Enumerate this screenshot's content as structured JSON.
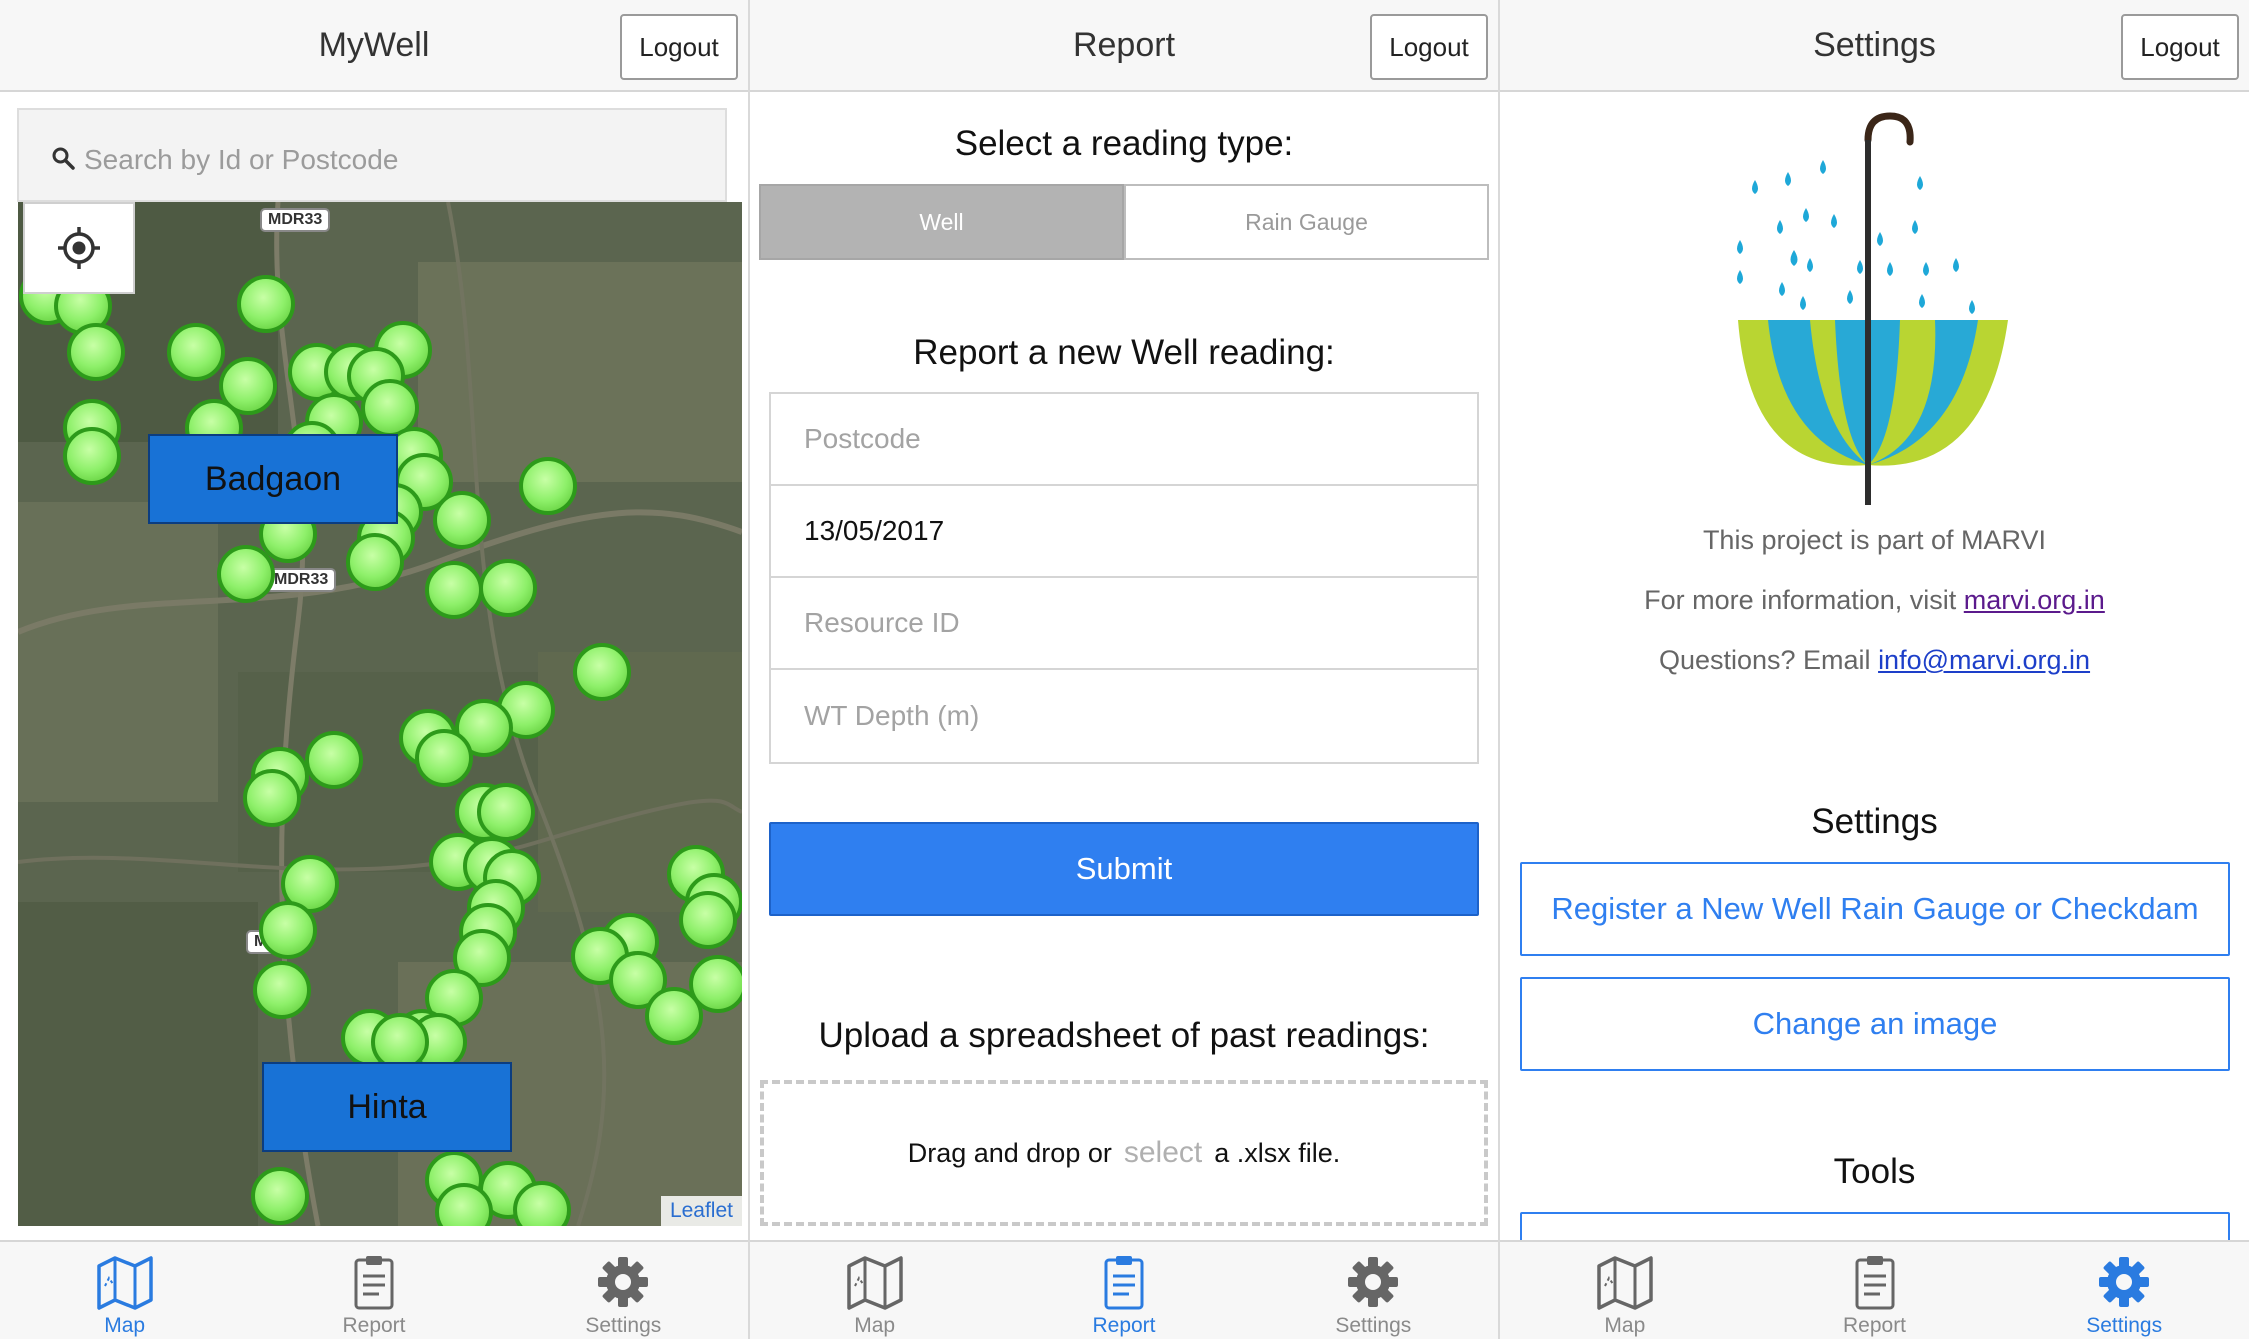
{
  "logout_label": "Logout",
  "tabs": [
    {
      "label": "Map",
      "icon": "map-icon"
    },
    {
      "label": "Report",
      "icon": "clipboard-icon"
    },
    {
      "label": "Settings",
      "icon": "gear-icon"
    }
  ],
  "colors": {
    "accent": "#2f7ff0",
    "marker": "#8ef06a",
    "place_label": "#1872d6"
  },
  "map_panel": {
    "title": "MyWell",
    "search_placeholder": "Search by Id or Postcode",
    "road_labels": [
      "MDR33",
      "MDR33",
      "M"
    ],
    "places": [
      "Badgaon",
      "Hinta"
    ],
    "attribution": "Leaflet",
    "active_tab": "Map"
  },
  "report_panel": {
    "title": "Report",
    "reading_type_heading": "Select a reading type:",
    "reading_types": [
      "Well",
      "Rain Gauge"
    ],
    "selected_type": "Well",
    "form_heading": "Report a new Well reading:",
    "fields": {
      "postcode_placeholder": "Postcode",
      "date_value": "13/05/2017",
      "resource_placeholder": "Resource ID",
      "depth_placeholder": "WT Depth (m)"
    },
    "submit_label": "Submit",
    "upload_heading": "Upload a spreadsheet of past readings:",
    "drop_text_before": "Drag and drop or",
    "drop_select": "select",
    "drop_text_after": "a .xlsx file.",
    "active_tab": "Report"
  },
  "settings_panel": {
    "title": "Settings",
    "project_text": "This project is part of MARVI",
    "info_prefix": "For more information, visit",
    "info_link": "marvi.org.in",
    "email_prefix": "Questions? Email",
    "email_link": "info@marvi.org.in",
    "settings_heading": "Settings",
    "register_button": "Register a New Well Rain Gauge or Checkdam",
    "change_image_button": "Change an image",
    "tools_heading": "Tools",
    "active_tab": "Settings"
  }
}
